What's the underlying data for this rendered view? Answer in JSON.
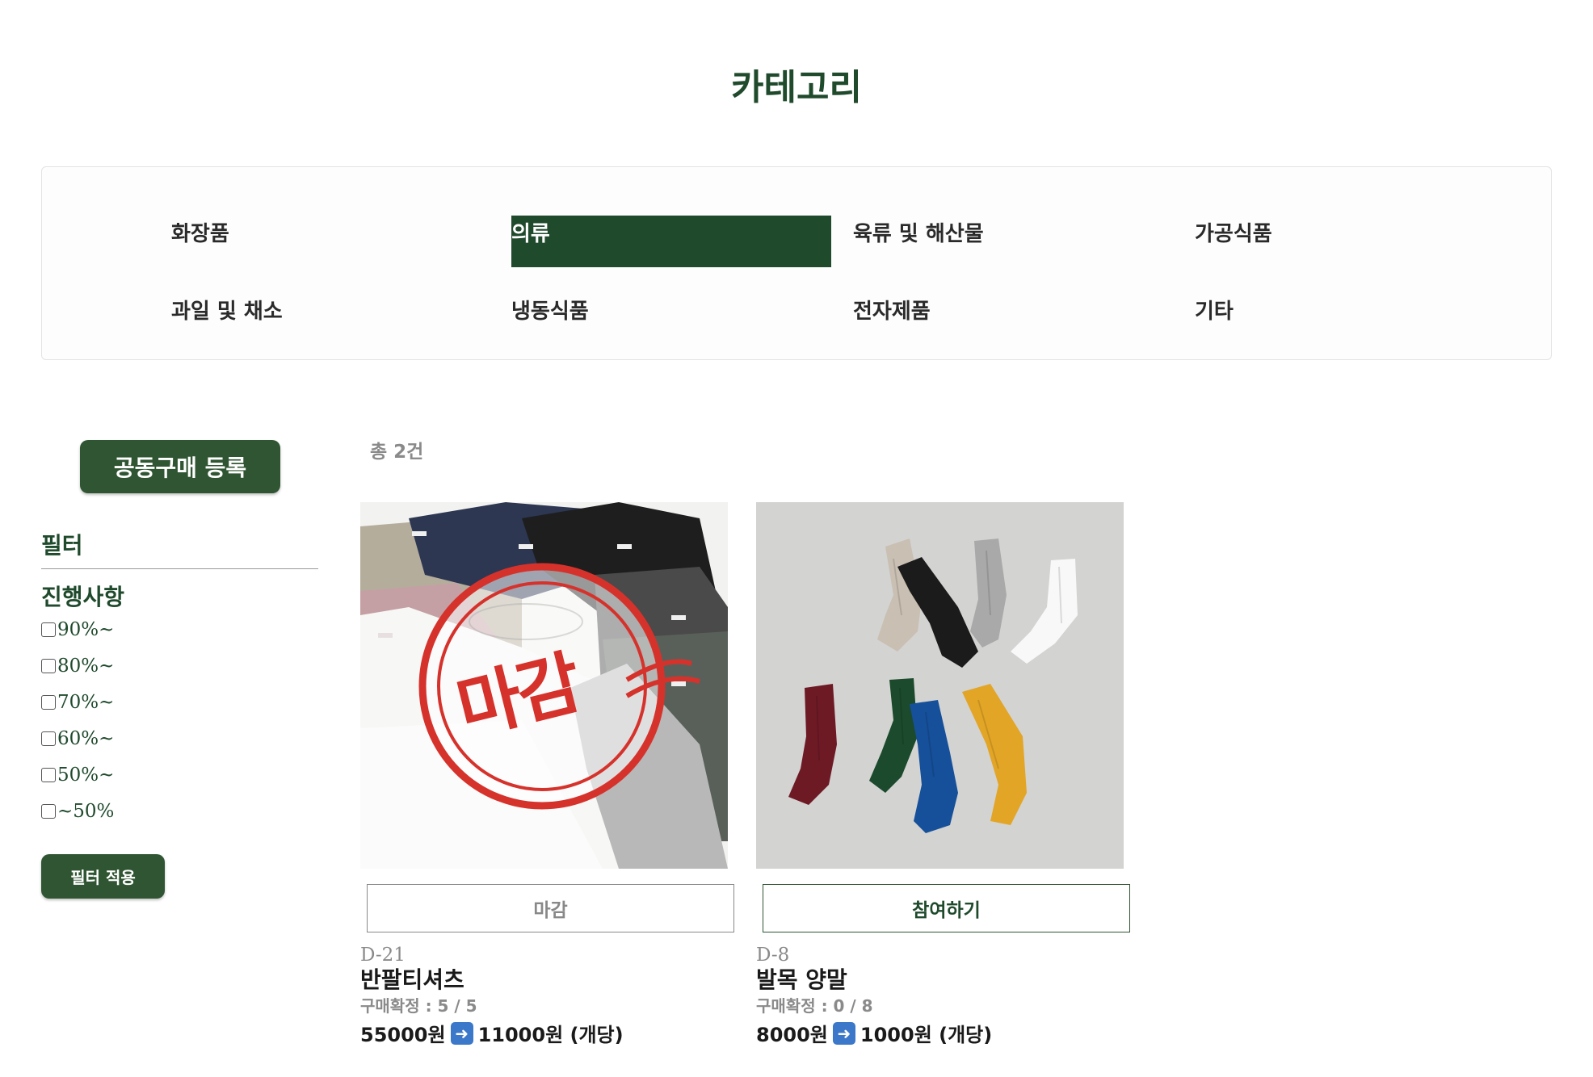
{
  "page": {
    "title": "카테고리"
  },
  "categories": [
    {
      "label": "화장품",
      "active": false
    },
    {
      "label": "의류",
      "active": true
    },
    {
      "label": "육류 및 해산물",
      "active": false
    },
    {
      "label": "가공식품",
      "active": false
    },
    {
      "label": "과일 및 채소",
      "active": false
    },
    {
      "label": "냉동식품",
      "active": false
    },
    {
      "label": "전자제품",
      "active": false
    },
    {
      "label": "기타",
      "active": false
    }
  ],
  "sidebar": {
    "register_label": "공동구매 등록",
    "filter_title": "필터",
    "progress_title": "진행사항",
    "options": [
      "90%~",
      "80%~",
      "70%~",
      "60%~",
      "50%~",
      "~50%"
    ],
    "apply_label": "필터 적용"
  },
  "listing": {
    "total": "총 2건"
  },
  "products": [
    {
      "image_icon": "tshirt-stack-image",
      "stamp": "마감",
      "button_label": "마감",
      "dday": "D-21",
      "name": "반팔티셔츠",
      "confirm": "구매확정 : 5 / 5",
      "original_price": "55000원",
      "arrow_icon": "right-arrow-icon",
      "unit_price": "11000원 (개당)"
    },
    {
      "image_icon": "socks-image",
      "button_label": "참여하기",
      "dday": "D-8",
      "name": "발목 양말",
      "confirm": "구매확정 : 0 / 8",
      "original_price": "8000원",
      "arrow_icon": "right-arrow-icon",
      "unit_price": "1000원 (개당)"
    }
  ],
  "colors": {
    "brand_green": "#1f4a2c",
    "button_green": "#2f5532",
    "stamp_red": "#d6322c"
  }
}
